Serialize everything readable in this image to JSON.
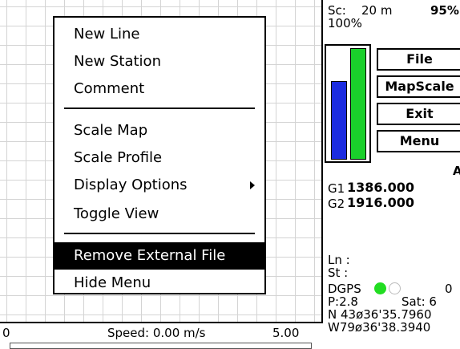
{
  "map": {
    "menu": {
      "items": [
        {
          "label": "New Line"
        },
        {
          "label": "New Station"
        },
        {
          "label": "Comment"
        },
        {
          "label": "Scale Map"
        },
        {
          "label": "Scale Profile"
        },
        {
          "label": "Display Options",
          "submenu": true
        },
        {
          "label": "Toggle View"
        },
        {
          "label": "Remove External File",
          "selected": true
        },
        {
          "label": "Hide Menu"
        }
      ]
    },
    "status": {
      "range_start": "0",
      "speed": "Speed: 0.00 m/s",
      "range_end": "5.00"
    }
  },
  "side": {
    "scale_label": "Sc:",
    "scale_value": "20 m",
    "battery": "95%",
    "zoom": "100%",
    "signal_bars": {
      "blue_level": 0.7,
      "green_level": 0.99
    },
    "buttons": {
      "file": "File",
      "mapscale": "MapScale",
      "exit": "Exit",
      "menu": "Menu"
    },
    "corner_letter": "A",
    "g1_label": "G1",
    "g1_value": "1386.000",
    "g2_label": "G2",
    "g2_value": "1916.000",
    "ln": "Ln :",
    "st": "St :",
    "dgps_label": "DGPS",
    "dgps_count": "0",
    "pdop": "P:2.8",
    "sat": "Sat: 6",
    "lat": "N 43ø36'35.7960",
    "lon": "W79ø36'38.3940"
  },
  "colors": {
    "blue_bar": "#1b2ce0",
    "green_bar": "#1ad02b",
    "dgps_dot": "#22dd22"
  }
}
